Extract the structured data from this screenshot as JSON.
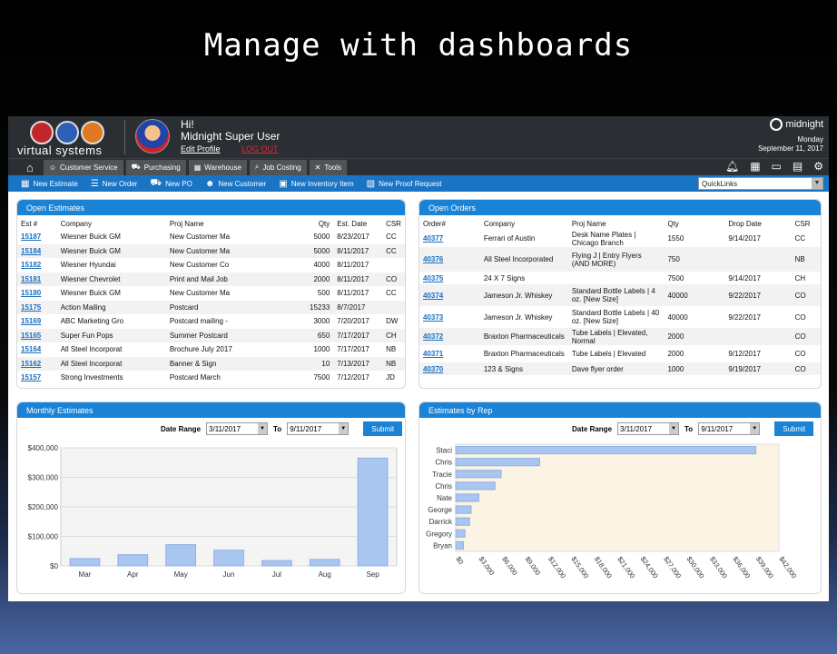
{
  "slide_title": "Manage with dashboards",
  "header": {
    "logo_text": "virtual systems",
    "greeting": "Hi!",
    "user_name": "Midnight Super User",
    "edit_profile": "Edit Profile",
    "logout": "LOG OUT",
    "brand": "midnight",
    "day": "Monday",
    "date": "September 11, 2017"
  },
  "nav": {
    "items": [
      "Customer Service",
      "Purchasing",
      "Warehouse",
      "Job Costing",
      "Tools"
    ]
  },
  "actions": {
    "items": [
      "New Estimate",
      "New Order",
      "New PO",
      "New Customer",
      "New Inventory Item",
      "New Proof Request"
    ],
    "quicklinks": "QuickLinks"
  },
  "open_estimates": {
    "title": "Open Estimates",
    "columns": [
      "Est #",
      "Company",
      "Proj Name",
      "Qty",
      "Est. Date",
      "CSR"
    ],
    "rows": [
      [
        "15187",
        "Wiesner Buick GM",
        "New Customer Ma",
        "5000",
        "8/23/2017",
        "CC"
      ],
      [
        "15184",
        "Wiesner Buick GM",
        "New Customer Ma",
        "5000",
        "8/11/2017",
        "CC"
      ],
      [
        "15182",
        "Wiesner Hyundai",
        "New Customer Co",
        "4000",
        "8/11/2017",
        ""
      ],
      [
        "15181",
        "Wiesner Chevrolet",
        "Print and Mail Job",
        "2000",
        "8/11/2017",
        "CO"
      ],
      [
        "15180",
        "Wiesner Buick GM",
        "New Customer Ma",
        "500",
        "8/11/2017",
        "CC"
      ],
      [
        "15175",
        "Action Mailing",
        "Postcard",
        "15233",
        "8/7/2017",
        ""
      ],
      [
        "15169",
        "ABC Marketing Gro",
        "Postcard mailing -",
        "3000",
        "7/20/2017",
        "DW"
      ],
      [
        "15165",
        "Super Fun Pops",
        "Summer Postcard",
        "650",
        "7/17/2017",
        "CH"
      ],
      [
        "15164",
        "All Steel Incorporat",
        "Brochure July 2017",
        "1000",
        "7/17/2017",
        "NB"
      ],
      [
        "15162",
        "All Steel Incorporat",
        "Banner & Sign",
        "10",
        "7/13/2017",
        "NB"
      ],
      [
        "15157",
        "Strong Investments",
        "Postcard March",
        "7500",
        "7/12/2017",
        "JD"
      ]
    ]
  },
  "open_orders": {
    "title": "Open Orders",
    "columns": [
      "Order#",
      "Company",
      "Proj Name",
      "Qty",
      "Drop Date",
      "CSR"
    ],
    "rows": [
      [
        "40377",
        "Ferrari of Austin",
        "Desk Name Plates | Chicago Branch",
        "1550",
        "9/14/2017",
        "CC"
      ],
      [
        "40376",
        "All Steel Incorporated",
        "Flying J | Entry Flyers (AND MORE)",
        "750",
        "",
        "NB"
      ],
      [
        "40375",
        "24 X 7 Signs",
        "",
        "7500",
        "9/14/2017",
        "CH"
      ],
      [
        "40374",
        "Jameson Jr. Whiskey",
        "Standard Bottle Labels | 4 oz. [New Size]",
        "40000",
        "9/22/2017",
        "CO"
      ],
      [
        "40373",
        "Jameson Jr. Whiskey",
        "Standard Bottle Labels | 40 oz. [New Size]",
        "40000",
        "9/22/2017",
        "CO"
      ],
      [
        "40372",
        "Braxton Pharmaceuticals",
        "Tube Labels | Elevated, Normal",
        "2000",
        "",
        "CO"
      ],
      [
        "40371",
        "Braxton Pharmaceuticals",
        "Tube Labels | Elevated",
        "2000",
        "9/12/2017",
        "CO"
      ],
      [
        "40370",
        "123 & Signs",
        "Dave flyer order",
        "1000",
        "9/19/2017",
        "CO"
      ]
    ]
  },
  "monthly_estimates": {
    "title": "Monthly Estimates",
    "date_range_label": "Date Range",
    "from": "3/11/2017",
    "to_label": "To",
    "to": "9/11/2017",
    "submit": "Submit"
  },
  "estimates_by_rep": {
    "title": "Estimates by Rep",
    "date_range_label": "Date Range",
    "from": "3/11/2017",
    "to_label": "To",
    "to": "9/11/2017",
    "submit": "Submit"
  },
  "chart_data": [
    {
      "type": "bar",
      "title": "Monthly Estimates",
      "categories": [
        "Mar",
        "Apr",
        "May",
        "Jun",
        "Jul",
        "Aug",
        "Sep"
      ],
      "values": [
        25000,
        38000,
        72000,
        53000,
        18000,
        22000,
        365000
      ],
      "ylim": [
        0,
        400000
      ],
      "yticks": [
        "$0",
        "$100,000",
        "$200,000",
        "$300,000",
        "$400,000"
      ],
      "ytick_values": [
        0,
        100000,
        200000,
        300000,
        400000
      ],
      "color": "#a9c6f0"
    },
    {
      "type": "bar",
      "orientation": "horizontal",
      "title": "Estimates by Rep",
      "categories": [
        "Staci",
        "Chris",
        "Tracie",
        "Chris",
        "Nate",
        "George",
        "Darrick",
        "Gregory",
        "Bryan"
      ],
      "values": [
        39000,
        10900,
        5900,
        5100,
        3000,
        2000,
        1800,
        1200,
        1000
      ],
      "xlim": [
        0,
        42000
      ],
      "xticks": [
        "$0",
        "$3,000",
        "$6,000",
        "$9,000",
        "$12,000",
        "$15,000",
        "$18,000",
        "$21,000",
        "$24,000",
        "$27,000",
        "$30,000",
        "$33,000",
        "$36,000",
        "$39,000",
        "$42,000"
      ],
      "color": "#a9c6f0"
    }
  ]
}
